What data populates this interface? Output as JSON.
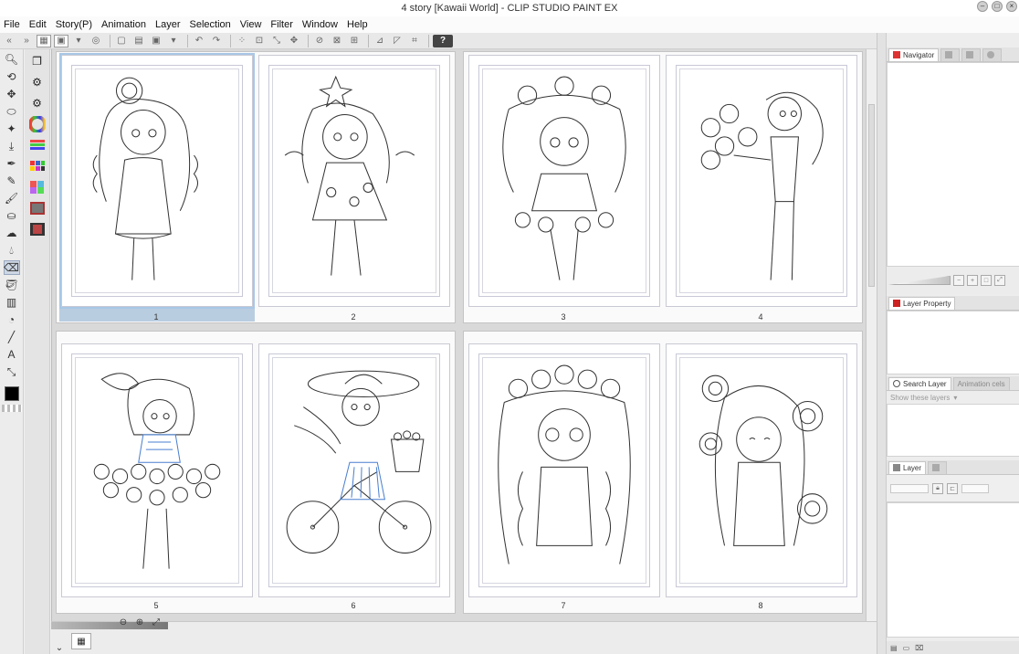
{
  "window": {
    "title": "4 story [Kawaii World] - CLIP STUDIO PAINT EX",
    "buttons": [
      "minimize-icon",
      "maximize-icon",
      "close-icon"
    ]
  },
  "menu": {
    "items": [
      "File",
      "Edit",
      "Story(P)",
      "Animation",
      "Layer",
      "Selection",
      "View",
      "Filter",
      "Window",
      "Help"
    ]
  },
  "commandbar": {
    "help_label": "?"
  },
  "canvas": {
    "pages": [
      {
        "number": "1",
        "selected": true
      },
      {
        "number": "2",
        "selected": false
      },
      {
        "number": "3",
        "selected": false
      },
      {
        "number": "4",
        "selected": false
      },
      {
        "number": "5",
        "selected": false
      },
      {
        "number": "6",
        "selected": false
      },
      {
        "number": "7",
        "selected": false
      },
      {
        "number": "8",
        "selected": false
      }
    ]
  },
  "panels": {
    "navigator": {
      "tab": "Navigator"
    },
    "layer_property": {
      "tab": "Layer Property"
    },
    "search_layer": {
      "tab": "Search Layer",
      "tab2": "Animation cels",
      "filter_placeholder": "Show these layers"
    },
    "layer": {
      "tab": "Layer"
    }
  },
  "colors": {
    "accent_blue": "#a8c7e6",
    "primary_color": "#000000",
    "line_art": "#333333",
    "highlight_blue": "#4a7fd0"
  }
}
